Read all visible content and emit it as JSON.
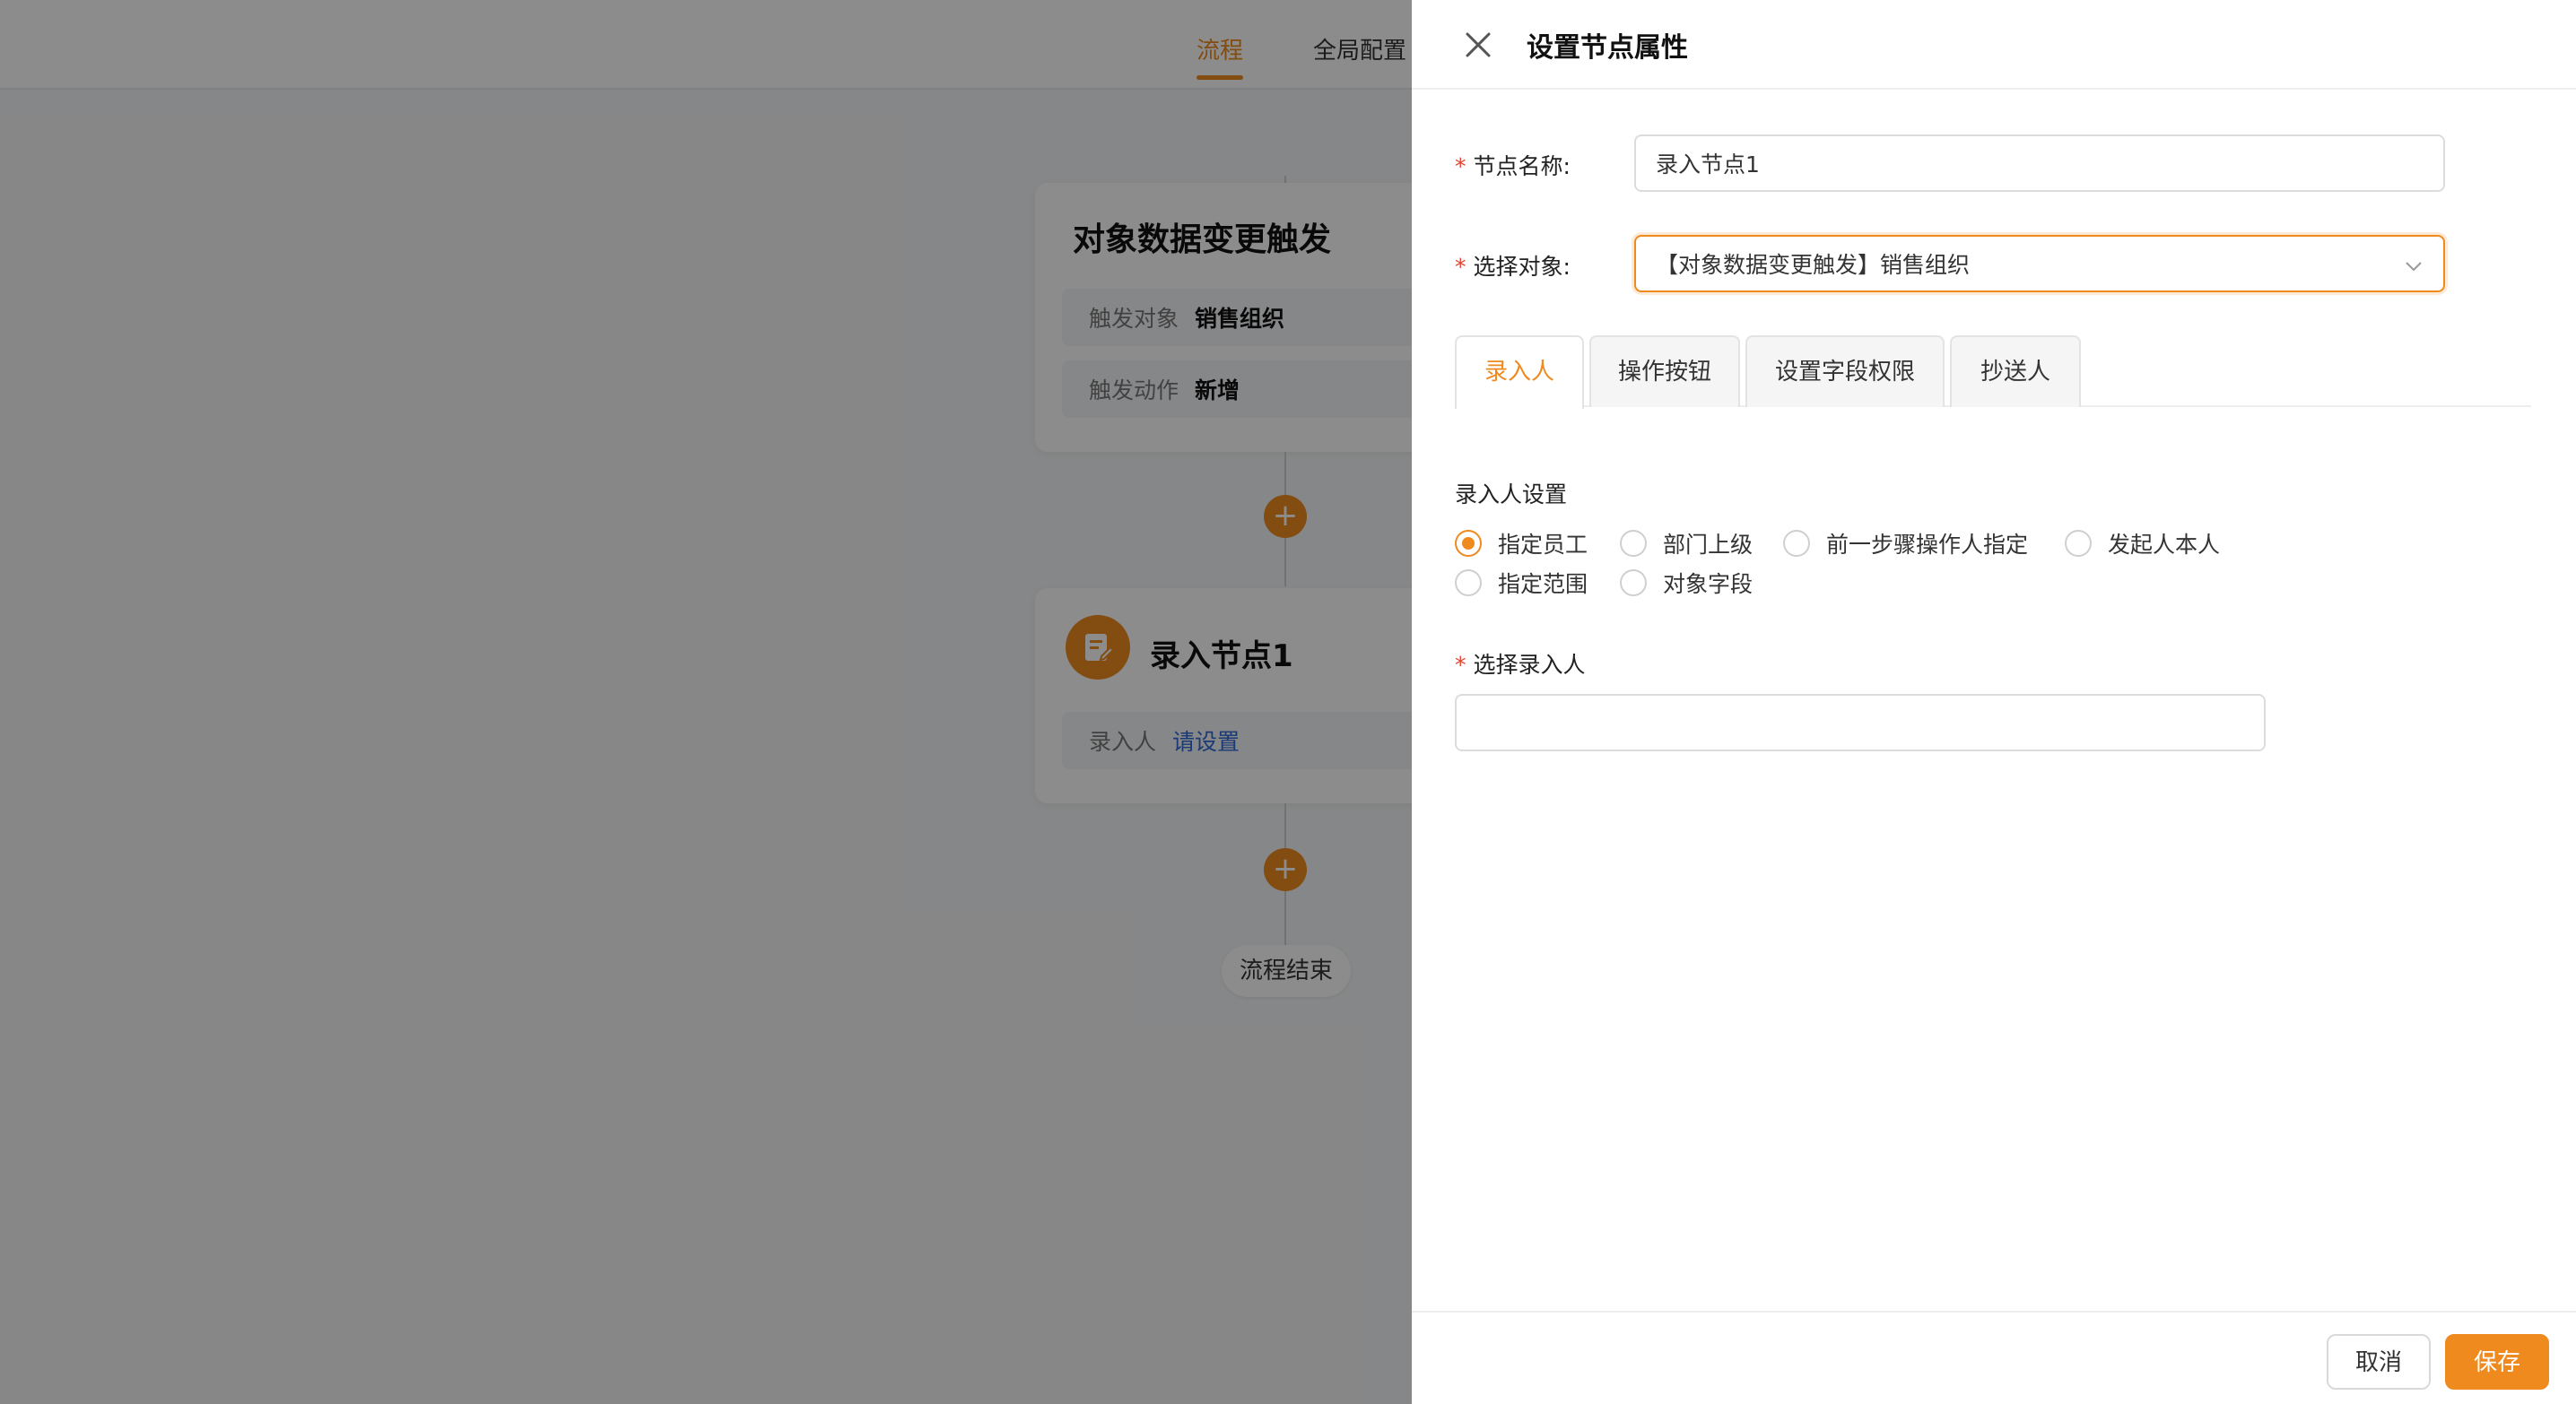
{
  "top_tabs": {
    "flow": "流程",
    "global_config": "全局配置"
  },
  "canvas": {
    "trigger_card": {
      "title": "对象数据变更触发",
      "rows": [
        {
          "key": "触发对象",
          "value": "销售组织"
        },
        {
          "key": "触发动作",
          "value": "新增"
        }
      ]
    },
    "node_card": {
      "title": "录入节点1",
      "row": {
        "key": "录入人",
        "value": "请设置"
      }
    },
    "plus": "+",
    "end_label": "流程结束"
  },
  "drawer": {
    "title": "设置节点属性",
    "node_name": {
      "label": "节点名称:",
      "value": "录入节点1"
    },
    "select_object": {
      "label": "选择对象:",
      "value": "【对象数据变更触发】销售组织"
    },
    "tabs": [
      "录入人",
      "操作按钮",
      "设置字段权限",
      "抄送人"
    ],
    "active_tab": "录入人",
    "entry_settings_label": "录入人设置",
    "radios": [
      {
        "label": "指定员工",
        "checked": true
      },
      {
        "label": "部门上级",
        "checked": false
      },
      {
        "label": "前一步骤操作人指定",
        "checked": false
      },
      {
        "label": "发起人本人",
        "checked": false
      },
      {
        "label": "指定范围",
        "checked": false
      },
      {
        "label": "对象字段",
        "checked": false
      }
    ],
    "choose_entry_label": "选择录入人",
    "choose_entry_value": "",
    "cancel_label": "取消",
    "save_label": "保存"
  },
  "colors": {
    "accent": "#ee8a1e",
    "link": "#2f6bd6",
    "required": "#e5432f"
  }
}
